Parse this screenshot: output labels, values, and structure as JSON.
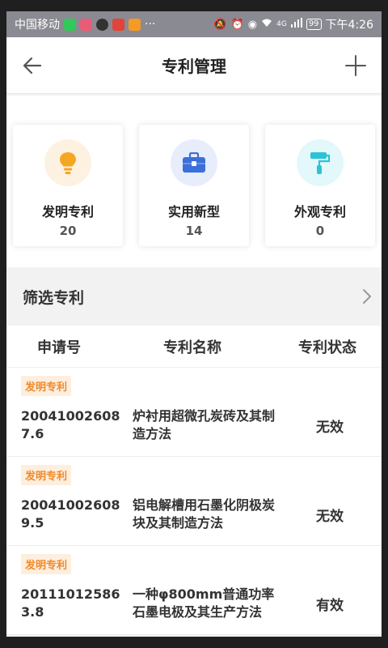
{
  "status_bar": {
    "carrier": "中国移动",
    "more": "···",
    "network": "4G",
    "battery": "99",
    "time": "下午4:26"
  },
  "header": {
    "title": "专利管理"
  },
  "stats": [
    {
      "label": "发明专利",
      "count": "20",
      "icon": "lightbulb-icon",
      "color": "#f5a623",
      "bg": "#fdf1e2"
    },
    {
      "label": "实用新型",
      "count": "14",
      "icon": "toolbox-icon",
      "color": "#3b6fd9",
      "bg": "#e7edfb"
    },
    {
      "label": "外观专利",
      "count": "0",
      "icon": "paint-roller-icon",
      "color": "#2cc3d6",
      "bg": "#e2f8fa"
    }
  ],
  "filter": {
    "label": "筛选专利"
  },
  "table": {
    "headers": {
      "no": "申请号",
      "name": "专利名称",
      "status": "专利状态"
    },
    "rows": [
      {
        "tag": "发明专利",
        "no": "200410026087.6",
        "name": "炉衬用超微孔炭砖及其制造方法",
        "status": "无效"
      },
      {
        "tag": "发明专利",
        "no": "200410026089.5",
        "name": "铝电解槽用石墨化阴极炭块及其制造方法",
        "status": "无效"
      },
      {
        "tag": "发明专利",
        "no": "201110125863.8",
        "name": "一种φ800mm普通功率石墨电极及其生产方法",
        "status": "有效"
      }
    ]
  }
}
